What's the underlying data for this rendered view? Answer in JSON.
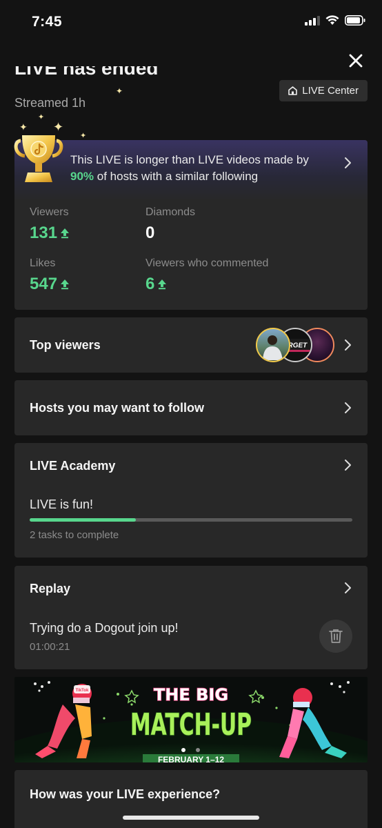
{
  "status_bar": {
    "time": "7:45"
  },
  "header": {
    "title": "LIVE has ended",
    "subtitle": "Streamed 1h",
    "live_center_label": "LIVE Center"
  },
  "summary": {
    "banner_text_a": "This LIVE is longer than LIVE videos made by ",
    "banner_percent": "90%",
    "banner_text_b": " of hosts with a similar following",
    "stats": [
      {
        "label": "Viewers",
        "value": "131",
        "trend": "up"
      },
      {
        "label": "Diamonds",
        "value": "0",
        "trend": "none"
      },
      {
        "label": "Likes",
        "value": "547",
        "trend": "up"
      },
      {
        "label": "Viewers who commented",
        "value": "6",
        "trend": "up"
      }
    ]
  },
  "top_viewers": {
    "title": "Top viewers",
    "avatar_text": "ORGET"
  },
  "hosts_follow": {
    "title": "Hosts you may want to follow"
  },
  "live_academy": {
    "title": "LIVE Academy",
    "task_name": "LIVE is fun!",
    "progress": 0.33,
    "tasks_text": "2 tasks to complete"
  },
  "replay": {
    "title": "Replay",
    "video_title": "Trying do a Dogout join up!",
    "duration": "01:00:21"
  },
  "promo": {
    "line1": "THE BIG",
    "line2": "MATCH-UP",
    "dates": "FEBRUARY 1–12",
    "tiktok_badge": "TikTok"
  },
  "feedback": {
    "title": "How was your LIVE experience?"
  },
  "colors": {
    "accent_green": "#58d68d",
    "background": "#131313",
    "card": "#282828"
  }
}
